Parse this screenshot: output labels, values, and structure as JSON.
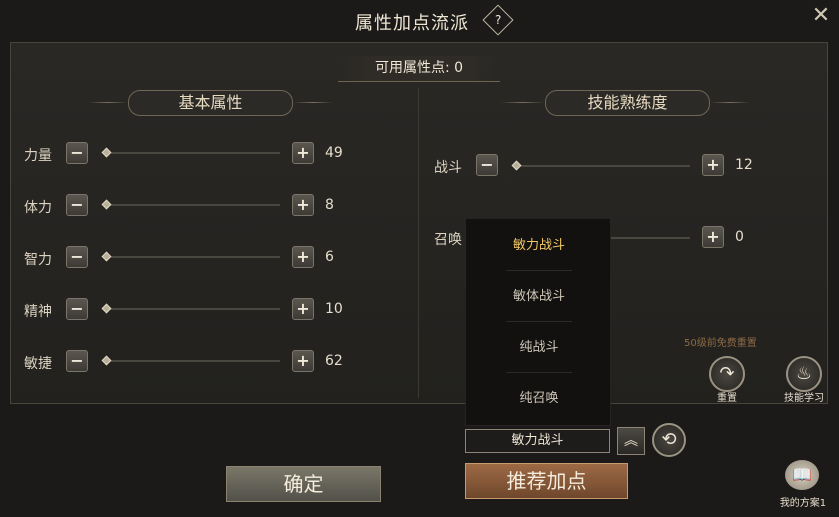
{
  "window": {
    "title": "属性加点流派",
    "help_icon": "question-icon",
    "close_icon": "close-icon"
  },
  "points": {
    "label": "可用属性点: 0"
  },
  "basic": {
    "header": "基本属性",
    "rows": [
      {
        "label": "力量",
        "value": "49"
      },
      {
        "label": "体力",
        "value": "8"
      },
      {
        "label": "智力",
        "value": "6"
      },
      {
        "label": "精神",
        "value": "10"
      },
      {
        "label": "敏捷",
        "value": "62"
      }
    ]
  },
  "skill": {
    "header": "技能熟练度",
    "rows": [
      {
        "label": "战斗",
        "value": "12"
      },
      {
        "label": "召唤",
        "value": "0"
      }
    ],
    "hint": "50级前免费重置",
    "reset_label": "重置",
    "learn_label": "技能学习"
  },
  "dropdown": {
    "options": [
      "敏力战斗",
      "敏体战斗",
      "纯战斗",
      "纯召唤"
    ],
    "selected_index": 0,
    "selected_value": "敏力战斗"
  },
  "buttons": {
    "confirm": "确定",
    "recommend": "推荐加点",
    "plan": "我的方案1",
    "minus_glyph": "−",
    "plus_glyph": "+"
  }
}
